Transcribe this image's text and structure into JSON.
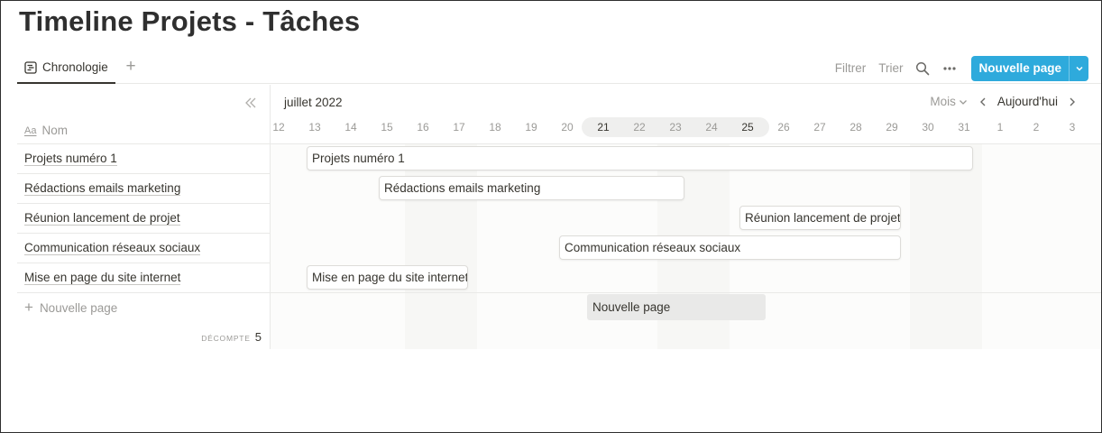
{
  "page": {
    "title": "Timeline Projets - Tâches"
  },
  "view_tabs": [
    {
      "label": "Chronologie",
      "icon": "timeline-view-icon"
    }
  ],
  "toolbar": {
    "filter_label": "Filtrer",
    "sort_label": "Trier",
    "search_icon": "search-icon",
    "more_icon": "more-horizontal-icon",
    "new_page_label": "Nouvelle page",
    "accent_color": "#2eaadc"
  },
  "table": {
    "name_column_label": "Nom",
    "name_column_icon_text": "Aa",
    "rows": [
      "Projets numéro 1",
      "Rédactions emails marketing",
      "Réunion lancement de projet",
      "Communication réseaux sociaux",
      "Mise en page du site internet"
    ],
    "add_row_label": "Nouvelle page",
    "count_label": "DÉCOMPTE",
    "count_value": "5"
  },
  "timeline": {
    "month_label": "juillet 2022",
    "scale_label": "Mois",
    "today_label": "Aujourd'hui",
    "days": [
      "12",
      "13",
      "14",
      "15",
      "16",
      "17",
      "18",
      "19",
      "20",
      "21",
      "22",
      "23",
      "24",
      "25",
      "26",
      "27",
      "28",
      "29",
      "30",
      "31",
      "1",
      "2",
      "3"
    ],
    "highlighted_days": [
      "21",
      "22",
      "23",
      "24",
      "25"
    ],
    "emphasized_days": [
      "21",
      "25"
    ],
    "weekend_days": [
      "16",
      "17",
      "23",
      "24",
      "30",
      "31"
    ],
    "tasks": [
      {
        "label": "Projets numéro 1",
        "start": "13",
        "end": "31"
      },
      {
        "label": "Rédactions emails marketing",
        "start": "15",
        "end": "23"
      },
      {
        "label": "Réunion lancement de projet",
        "start": "25",
        "end": "29"
      },
      {
        "label": "Communication réseaux sociaux",
        "start": "20",
        "end": "29"
      },
      {
        "label": "Mise en page du site internet",
        "start": "13",
        "end": "17"
      }
    ],
    "placeholder": {
      "label": "Nouvelle page",
      "start": "21",
      "end": "25"
    }
  }
}
